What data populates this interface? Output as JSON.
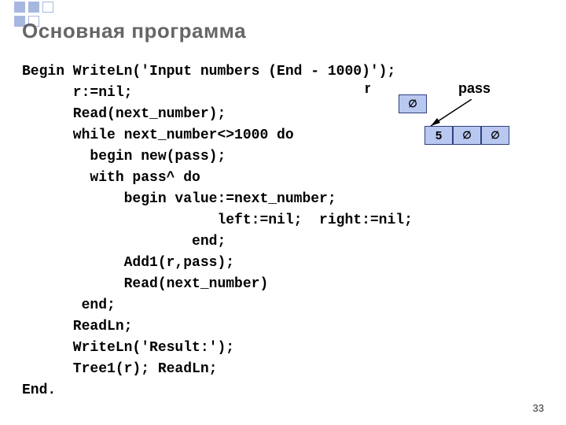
{
  "title": "Основная программа",
  "code_lines": [
    "Begin WriteLn('Input numbers (End - 1000)');",
    "      r:=nil;",
    "      Read(next_number);",
    "      while next_number<>1000 do",
    "        begin new(pass);",
    "        with pass^ do",
    "            begin value:=next_number;",
    "                       left:=nil;  right:=nil;",
    "                    end;",
    "            Add1(r,pass);",
    "            Read(next_number)",
    "       end;",
    "      ReadLn;",
    "      WriteLn('Result:');",
    "      Tree1(r); ReadLn;",
    "End."
  ],
  "diagram": {
    "r_label": "r",
    "pass_label": "pass",
    "r_cell": "∅",
    "node_value": "5",
    "node_left": "∅",
    "node_right": "∅"
  },
  "page_number": "33"
}
